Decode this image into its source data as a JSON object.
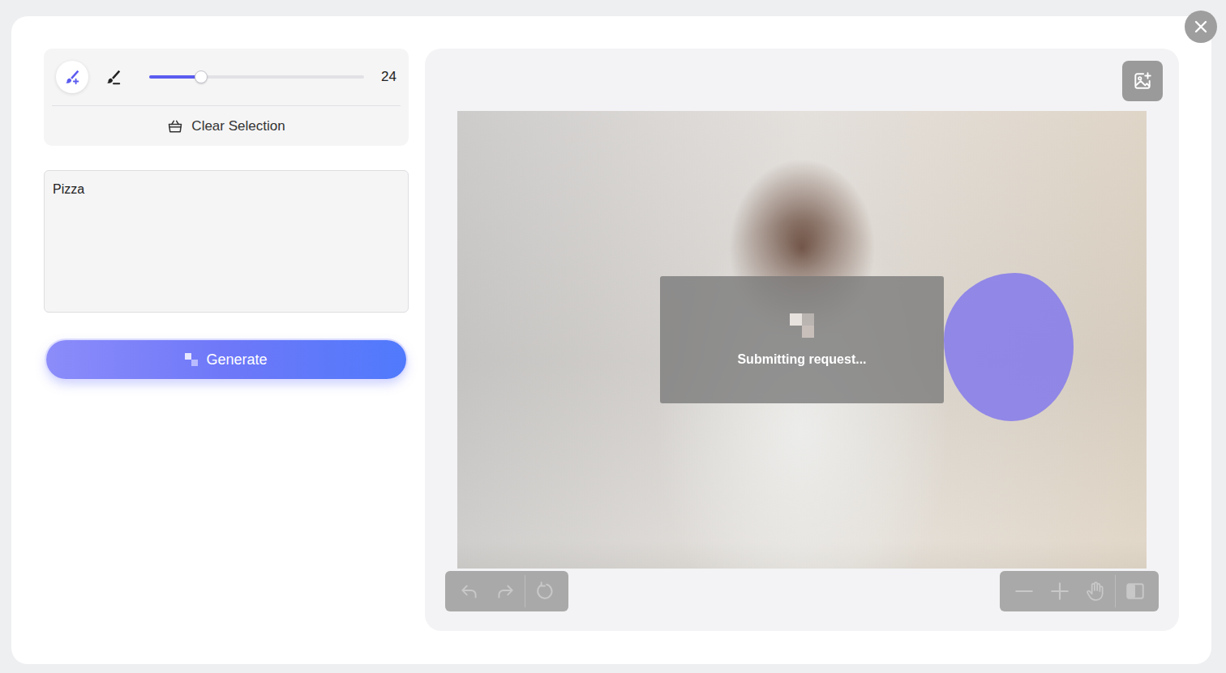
{
  "brush_tools": [
    {
      "kind": "add",
      "selected": true
    },
    {
      "kind": "erase",
      "selected": false
    }
  ],
  "brush_size": {
    "level": 0.24,
    "reading": "24"
  },
  "clear_button": {
    "label": "Clear Selection"
  },
  "prompt": {
    "value": "Pizza"
  },
  "generate_button": {
    "label": "Generate"
  },
  "canvas": {
    "status": "Submitting request..."
  },
  "history_toolbar": {
    "disabled": true,
    "buttons": [
      {
        "kind": "undo"
      },
      {
        "kind": "redo"
      },
      {
        "kind": "reset"
      }
    ]
  },
  "view_toolbar": {
    "disabled": true,
    "buttons": [
      {
        "kind": "zoom-out"
      },
      {
        "kind": "zoom-in"
      },
      {
        "kind": "pan"
      },
      {
        "kind": "compare"
      }
    ]
  }
}
